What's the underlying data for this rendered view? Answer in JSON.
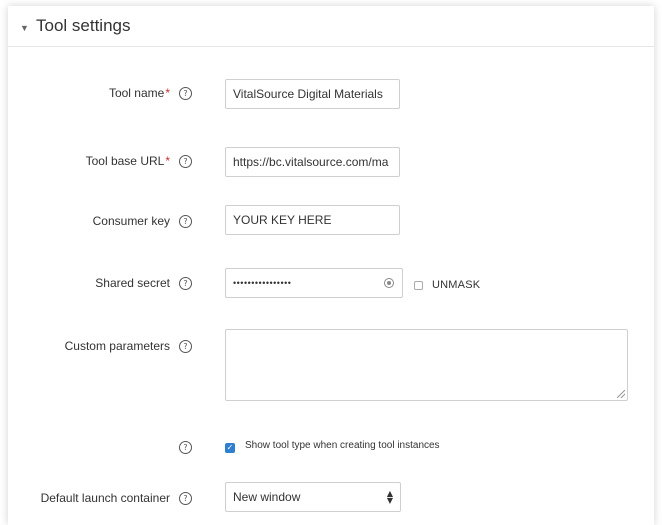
{
  "section": {
    "title": "Tool settings",
    "collapse_icon": "chevron-down-icon"
  },
  "fields": {
    "tool_name": {
      "label": "Tool name",
      "required_mark": "*",
      "value": "VitalSource Digital Materials"
    },
    "tool_base_url": {
      "label": "Tool base URL",
      "required_mark": "*",
      "value": "https://bc.vitalsource.com/ma"
    },
    "consumer_key": {
      "label": "Consumer key",
      "value": "YOUR KEY HERE"
    },
    "shared_secret": {
      "label": "Shared secret",
      "value": "••••••••••••••••",
      "unmask_label": "UNMASK",
      "unmask_checked": false
    },
    "custom_parameters": {
      "label": "Custom parameters",
      "value": ""
    },
    "show_tool_type": {
      "label": "Show tool type when creating tool instances",
      "checked": true,
      "check_glyph": "✓"
    },
    "default_launch_container": {
      "label": "Default launch container",
      "value": "New window",
      "arrows": "▲▼"
    }
  },
  "icons": {
    "help": "?",
    "help_icon_name": "help-circle-icon"
  },
  "colors": {
    "required": "#c9302c",
    "checkbox": "#2f7fd1"
  }
}
